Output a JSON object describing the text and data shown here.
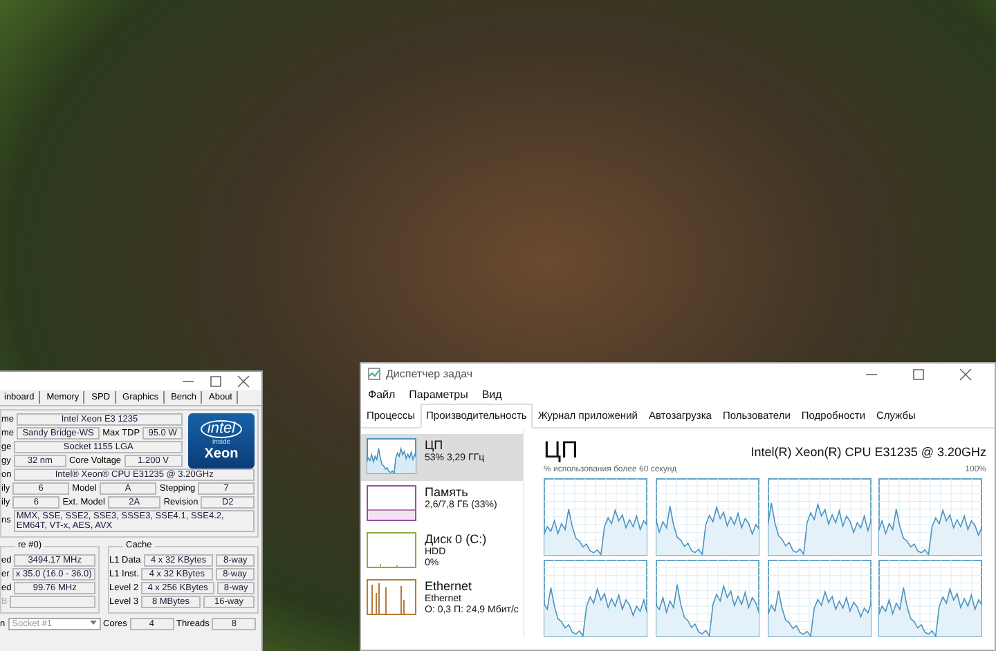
{
  "cpuz": {
    "tabs": [
      {
        "label": "inboard",
        "selected": false
      },
      {
        "label": "Memory",
        "selected": false
      },
      {
        "label": "SPD",
        "selected": false
      },
      {
        "label": "Graphics",
        "selected": false
      },
      {
        "label": "Bench",
        "selected": false
      },
      {
        "label": "About",
        "selected": false
      }
    ],
    "processor": {
      "top_rows": [
        [
          {
            "kind": "label",
            "text": "me"
          },
          {
            "kind": "field",
            "text": "Intel Xeon E3 1235"
          }
        ],
        [
          {
            "kind": "label",
            "text": "me"
          },
          {
            "kind": "field",
            "text": "Sandy Bridge-WS"
          },
          {
            "kind": "label",
            "text": "Max TDP"
          },
          {
            "kind": "field",
            "text": "95.0 W"
          }
        ],
        [
          {
            "kind": "label",
            "text": "ge"
          },
          {
            "kind": "field",
            "text": "Socket 1155 LGA"
          }
        ],
        [
          {
            "kind": "label",
            "text": "gy"
          },
          {
            "kind": "field",
            "text": "32 nm"
          },
          {
            "kind": "label",
            "text": "Core Voltage"
          },
          {
            "kind": "field",
            "text": "1.200 V"
          }
        ]
      ],
      "logo": {
        "brand": "intel",
        "tag": "inside",
        "product": "Xeon"
      },
      "rows": [
        [
          {
            "kind": "label",
            "text": "on"
          },
          {
            "kind": "field",
            "text": "Intel® Xeon® CPU E31235 @ 3.20GHz"
          }
        ],
        [
          {
            "kind": "label",
            "text": "ily"
          },
          {
            "kind": "field",
            "text": "6"
          },
          {
            "kind": "label",
            "text": "Model"
          },
          {
            "kind": "field",
            "text": "A"
          },
          {
            "kind": "label",
            "text": "Stepping"
          },
          {
            "kind": "field",
            "text": "7"
          }
        ],
        [
          {
            "kind": "label",
            "text": "ily"
          },
          {
            "kind": "field",
            "text": "6"
          },
          {
            "kind": "label",
            "text": "Ext. Model"
          },
          {
            "kind": "field",
            "text": "2A"
          },
          {
            "kind": "label",
            "text": "Revision"
          },
          {
            "kind": "field",
            "text": "D2"
          }
        ],
        [
          {
            "kind": "label",
            "text": "ns"
          },
          {
            "kind": "multiline",
            "text": "MMX, SSE, SSE2, SSE3, SSSE3, SSE4.1, SSE4.2, EM64T, VT-x, AES, AVX"
          }
        ]
      ]
    },
    "clocks": {
      "title": "re #0)",
      "rows": [
        [
          {
            "kind": "label",
            "text": "ed"
          },
          {
            "kind": "field",
            "text": "3494.17 MHz"
          }
        ],
        [
          {
            "kind": "label",
            "text": "er"
          },
          {
            "kind": "field",
            "text": "x 35.0 (16.0 - 36.0)"
          }
        ],
        [
          {
            "kind": "label",
            "text": "ed"
          },
          {
            "kind": "field",
            "text": "99.76 MHz"
          }
        ],
        [
          {
            "kind": "label",
            "text": "B",
            "disabled": true
          },
          {
            "kind": "field",
            "text": ""
          }
        ]
      ]
    },
    "cache": {
      "title": "Cache",
      "rows": [
        [
          {
            "kind": "label",
            "text": "L1 Data"
          },
          {
            "kind": "field",
            "text": "4 x 32 KBytes"
          },
          {
            "kind": "field",
            "text": "8-way"
          }
        ],
        [
          {
            "kind": "label",
            "text": "L1 Inst."
          },
          {
            "kind": "field",
            "text": "4 x 32 KBytes"
          },
          {
            "kind": "field",
            "text": "8-way"
          }
        ],
        [
          {
            "kind": "label",
            "text": "Level 2"
          },
          {
            "kind": "field",
            "text": "4 x 256 KBytes"
          },
          {
            "kind": "field",
            "text": "8-way"
          }
        ],
        [
          {
            "kind": "label",
            "text": "Level 3"
          },
          {
            "kind": "field",
            "text": "8 MBytes"
          },
          {
            "kind": "field",
            "text": "16-way"
          }
        ]
      ]
    },
    "bottom": [
      {
        "kind": "label",
        "text": "n"
      },
      {
        "kind": "select",
        "text": "Socket #1"
      },
      {
        "kind": "label",
        "text": "Cores"
      },
      {
        "kind": "field",
        "text": "4"
      },
      {
        "kind": "label",
        "text": "Threads"
      },
      {
        "kind": "field",
        "text": "8"
      }
    ]
  },
  "taskmgr": {
    "title": "Диспетчер задач",
    "menu": [
      "Файл",
      "Параметры",
      "Вид"
    ],
    "tabs": [
      {
        "label": "Процессы",
        "selected": false
      },
      {
        "label": "Производительность",
        "selected": true
      },
      {
        "label": "Журнал приложений",
        "selected": false
      },
      {
        "label": "Автозагрузка",
        "selected": false
      },
      {
        "label": "Пользователи",
        "selected": false
      },
      {
        "label": "Подробности",
        "selected": false
      },
      {
        "label": "Службы",
        "selected": false
      }
    ],
    "resources": [
      {
        "kind": "cpu",
        "title": "ЦП",
        "lines": [
          "53% 3,29 ГГц"
        ],
        "color": "#4a94c0",
        "selected": true
      },
      {
        "kind": "memory",
        "title": "Память",
        "lines": [
          "2,6/7,8 ГБ (33%)"
        ],
        "color": "#9a4f9e",
        "selected": false
      },
      {
        "kind": "disk",
        "title": "Диск 0 (C:)",
        "lines": [
          "HDD",
          "0%"
        ],
        "color": "#8aae3c",
        "selected": false
      },
      {
        "kind": "network",
        "title": "Ethernet",
        "lines": [
          "Ethernet",
          "О: 0,3 П: 24,9 Мбит/с"
        ],
        "color": "#b8793a",
        "selected": false
      }
    ],
    "detail": {
      "title": "ЦП",
      "model": "Intel(R) Xeon(R) CPU E31235 @ 3.20GHz",
      "caption": "% использования более 60 секунд",
      "max_label": "100%",
      "graphs": [
        {
          "kind": "core"
        },
        {
          "kind": "core"
        },
        {
          "kind": "core"
        },
        {
          "kind": "core"
        },
        {
          "kind": "core"
        },
        {
          "kind": "core"
        },
        {
          "kind": "core"
        },
        {
          "kind": "core"
        }
      ]
    }
  }
}
